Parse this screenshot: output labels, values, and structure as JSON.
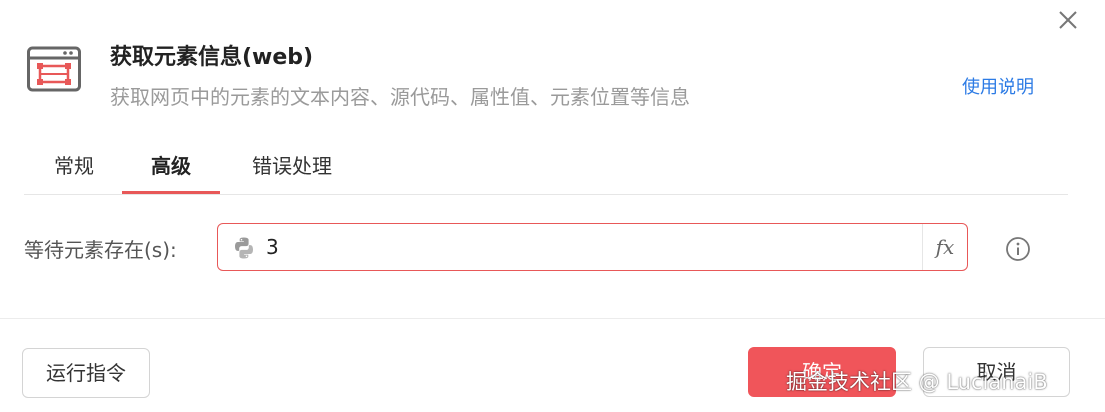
{
  "dialog": {
    "close_label": "✕",
    "title": "获取元素信息(web)",
    "description": "获取网页中的元素的文本内容、源代码、属性值、元素位置等信息",
    "help_link": "使用说明",
    "icon": "browser-window-icon"
  },
  "tabs": [
    {
      "label": "常规",
      "active": false
    },
    {
      "label": "高级",
      "active": true
    },
    {
      "label": "错误处理",
      "active": false
    }
  ],
  "form": {
    "wait_label": "等待元素存在(s):",
    "wait_value": "3",
    "fx_label": "fx",
    "input_icon": "python-icon",
    "info_icon": "info-icon"
  },
  "footer": {
    "run_label": "运行指令",
    "ok_label": "确定",
    "cancel_label": "取消"
  },
  "watermark": "掘金技术社区 @ LucianaiB",
  "colors": {
    "accent": "#e85858",
    "primary_button": "#f0555a",
    "link": "#2c7be5",
    "muted_text": "#9a9a9a"
  }
}
